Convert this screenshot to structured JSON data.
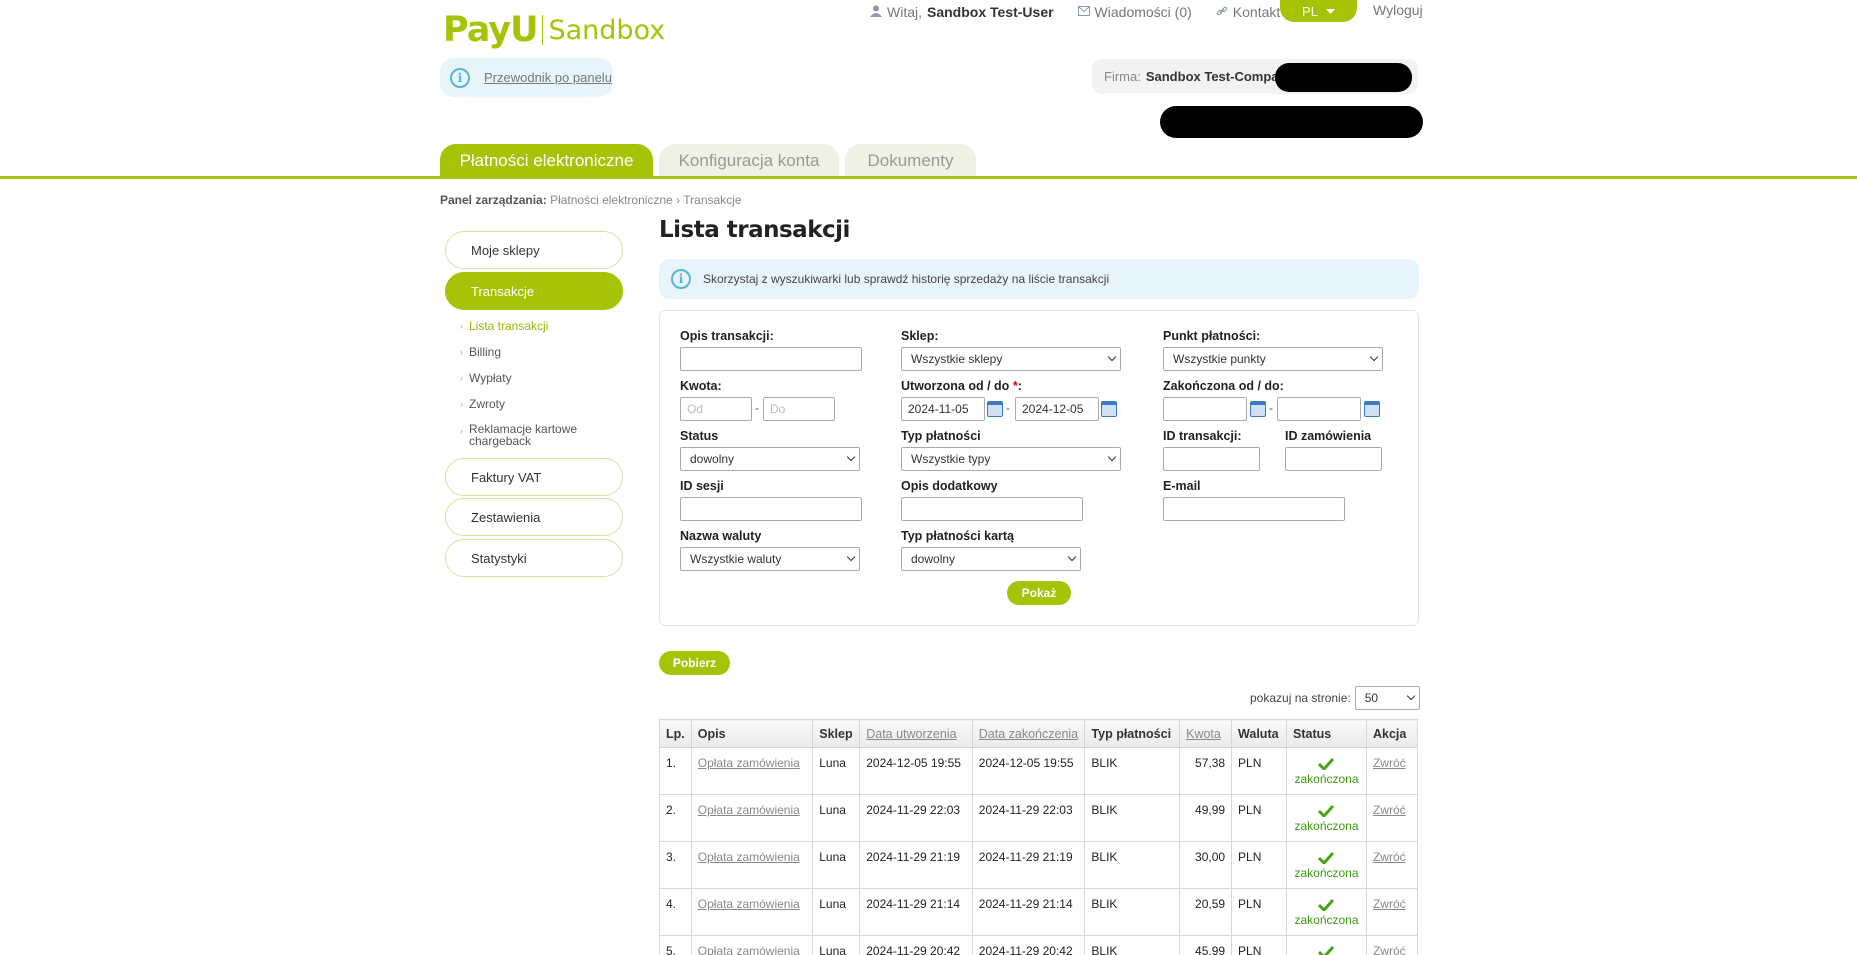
{
  "header": {
    "logo_brand": "PayU",
    "logo_env": "Sandbox",
    "greeting": "Witaj,",
    "user": "Sandbox Test-User",
    "messages": "Wiadomości (0)",
    "contact": "Kontakt",
    "lang": "PL",
    "logout": "Wyloguj",
    "guide": "Przewodnik po panelu",
    "firm_label": "Firma:",
    "firm_name": "Sandbox Test-Company"
  },
  "tabs": [
    "Płatności elektroniczne",
    "Konfiguracja konta",
    "Dokumenty"
  ],
  "breadcrumb": {
    "label": "Panel zarządzania:",
    "path1": "Płatności elektroniczne",
    "sep": "›",
    "path2": "Transakcje"
  },
  "sidebar": {
    "items": [
      "Moje sklepy",
      "Transakcje",
      "Faktury VAT",
      "Zestawienia",
      "Statystyki"
    ],
    "sub": [
      "Lista transakcji",
      "Billing",
      "Wypłaty",
      "Zwroty",
      "Reklamacje kartowe chargeback"
    ]
  },
  "main": {
    "title": "Lista transakcji",
    "hint": "Skorzystaj z wyszukiwarki lub sprawdź historię sprzedaży na liście transakcji"
  },
  "filters": {
    "opis_label": "Opis transakcji:",
    "sklep_label": "Sklep:",
    "sklep_value": "Wszystkie sklepy",
    "punkt_label": "Punkt płatności:",
    "punkt_value": "Wszystkie punkty",
    "kwota_label": "Kwota:",
    "kwota_od": "Od",
    "kwota_do": "Do",
    "utworzona_label": "Utworzona od / do",
    "utworzona_req": "*",
    "utworzona_colon": ":",
    "utworzona_od": "2024-11-05",
    "utworzona_do": "2024-12-05",
    "zakonczona_label": "Zakończona od / do:",
    "status_label": "Status",
    "status_value": "dowolny",
    "typ_label": "Typ płatności",
    "typ_value": "Wszystkie typy",
    "id_trans_label": "ID transakcji:",
    "id_zam_label": "ID zamówienia",
    "id_sesji_label": "ID sesji",
    "opis_dod_label": "Opis dodatkowy",
    "email_label": "E-mail",
    "waluta_label": "Nazwa waluty",
    "waluta_value": "Wszystkie waluty",
    "karta_label": "Typ płatności kartą",
    "karta_value": "dowolny",
    "dash": "-",
    "show_button": "Pokaż"
  },
  "download_button": "Pobierz",
  "per_page": {
    "label": "pokazuj na stronie:",
    "value": "50"
  },
  "table": {
    "headers": [
      "Lp.",
      "Opis",
      "Sklep",
      "Data utworzenia",
      "Data zakończenia",
      "Typ płatności",
      "Kwota",
      "Waluta",
      "Status",
      "Akcja"
    ],
    "rows": [
      {
        "lp": "1.",
        "opis": "Opłata zamówienia",
        "sklep": "Luna",
        "created": "2024-12-05 19:55",
        "finished": "2024-12-05 19:55",
        "typ": "BLIK",
        "kwota": "57,38",
        "waluta": "PLN",
        "status": "zakończona",
        "akcja": "Zwróć"
      },
      {
        "lp": "2.",
        "opis": "Opłata zamówienia",
        "sklep": "Luna",
        "created": "2024-11-29 22:03",
        "finished": "2024-11-29 22:03",
        "typ": "BLIK",
        "kwota": "49,99",
        "waluta": "PLN",
        "status": "zakończona",
        "akcja": "Zwróć"
      },
      {
        "lp": "3.",
        "opis": "Opłata zamówienia",
        "sklep": "Luna",
        "created": "2024-11-29 21:19",
        "finished": "2024-11-29 21:19",
        "typ": "BLIK",
        "kwota": "30,00",
        "waluta": "PLN",
        "status": "zakończona",
        "akcja": "Zwróć"
      },
      {
        "lp": "4.",
        "opis": "Opłata zamówienia",
        "sklep": "Luna",
        "created": "2024-11-29 21:14",
        "finished": "2024-11-29 21:14",
        "typ": "BLIK",
        "kwota": "20,59",
        "waluta": "PLN",
        "status": "zakończona",
        "akcja": "Zwróć"
      },
      {
        "lp": "5.",
        "opis": "Opłata zamówienia",
        "sklep": "Luna",
        "created": "2024-11-29 20:42",
        "finished": "2024-11-29 20:42",
        "typ": "BLIK",
        "kwota": "45,99",
        "waluta": "PLN",
        "status": "zakończona",
        "akcja": "Zwróć"
      }
    ]
  },
  "colors": {
    "brand": "#a6c307",
    "info_bg": "#e7f5fb",
    "status_ok": "#3f9a12"
  }
}
